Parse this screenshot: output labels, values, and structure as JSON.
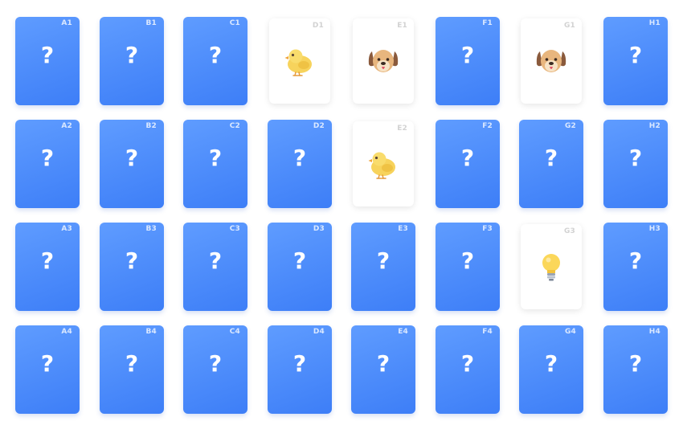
{
  "hidden_symbol": "?",
  "rows": [
    [
      {
        "id": "A1",
        "state": "hidden"
      },
      {
        "id": "B1",
        "state": "hidden"
      },
      {
        "id": "C1",
        "state": "hidden"
      },
      {
        "id": "D1",
        "state": "revealed",
        "icon": "chick-icon"
      },
      {
        "id": "E1",
        "state": "revealed",
        "icon": "dog-icon"
      },
      {
        "id": "F1",
        "state": "hidden"
      },
      {
        "id": "G1",
        "state": "revealed",
        "icon": "dog-icon"
      },
      {
        "id": "H1",
        "state": "hidden"
      }
    ],
    [
      {
        "id": "A2",
        "state": "hidden"
      },
      {
        "id": "B2",
        "state": "hidden"
      },
      {
        "id": "C2",
        "state": "hidden"
      },
      {
        "id": "D2",
        "state": "hidden"
      },
      {
        "id": "E2",
        "state": "revealed",
        "icon": "chick-icon"
      },
      {
        "id": "F2",
        "state": "hidden"
      },
      {
        "id": "G2",
        "state": "hidden"
      },
      {
        "id": "H2",
        "state": "hidden"
      }
    ],
    [
      {
        "id": "A3",
        "state": "hidden"
      },
      {
        "id": "B3",
        "state": "hidden"
      },
      {
        "id": "C3",
        "state": "hidden"
      },
      {
        "id": "D3",
        "state": "hidden"
      },
      {
        "id": "E3",
        "state": "hidden"
      },
      {
        "id": "F3",
        "state": "hidden"
      },
      {
        "id": "G3",
        "state": "revealed",
        "icon": "lightbulb-icon"
      },
      {
        "id": "H3",
        "state": "hidden"
      }
    ],
    [
      {
        "id": "A4",
        "state": "hidden"
      },
      {
        "id": "B4",
        "state": "hidden"
      },
      {
        "id": "C4",
        "state": "hidden"
      },
      {
        "id": "D4",
        "state": "hidden"
      },
      {
        "id": "E4",
        "state": "hidden"
      },
      {
        "id": "F4",
        "state": "hidden"
      },
      {
        "id": "G4",
        "state": "hidden"
      },
      {
        "id": "H4",
        "state": "hidden"
      }
    ]
  ],
  "colors": {
    "card_back": "#4a88fb",
    "card_face": "#ffffff"
  }
}
